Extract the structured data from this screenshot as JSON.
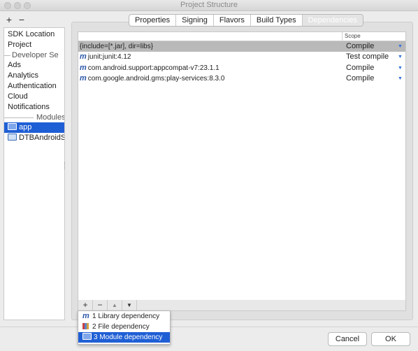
{
  "window": {
    "title": "Project Structure"
  },
  "left_toolbar": {
    "add": "+",
    "remove": "−"
  },
  "sidebar": {
    "items": [
      "SDK Location",
      "Project"
    ],
    "developer_services_label": "Developer Se",
    "services": [
      "Ads",
      "Analytics",
      "Authentication",
      "Cloud",
      "Notifications"
    ],
    "modules_label": "Modules",
    "modules": [
      "app",
      "DTBAndroidSD"
    ],
    "selected_module": "app"
  },
  "tabs": [
    {
      "label": "Properties",
      "active": false
    },
    {
      "label": "Signing",
      "active": false
    },
    {
      "label": "Flavors",
      "active": false
    },
    {
      "label": "Build Types",
      "active": false
    },
    {
      "label": "Dependencies",
      "active": true
    }
  ],
  "dependencies": {
    "scope_header": "Scope",
    "rows": [
      {
        "name": "{include=[*.jar], dir=libs}",
        "scope": "Compile",
        "selected": true,
        "maven": false
      },
      {
        "name": "junit:junit:4.12",
        "scope": "Test compile",
        "selected": false,
        "maven": true
      },
      {
        "name": "com.android.support:appcompat-v7:23.1.1",
        "scope": "Compile",
        "selected": false,
        "maven": true
      },
      {
        "name": "com.google.android.gms:play-services:8.3.0",
        "scope": "Compile",
        "selected": false,
        "maven": true
      }
    ]
  },
  "bottom_toolbar": {
    "add": "+",
    "remove": "−",
    "up": "▲",
    "down": "▼"
  },
  "add_menu": {
    "items": [
      {
        "label": "1  Library dependency",
        "icon": "maven-library-icon",
        "selected": false
      },
      {
        "label": "2  File dependency",
        "icon": "file-jar-icon",
        "selected": false
      },
      {
        "label": "3  Module dependency",
        "icon": "module-folder-icon",
        "selected": true
      }
    ]
  },
  "buttons": {
    "cancel": "Cancel",
    "ok": "OK"
  },
  "colors": {
    "selection": "#1f5fd5",
    "accent": "#2b57a8"
  }
}
